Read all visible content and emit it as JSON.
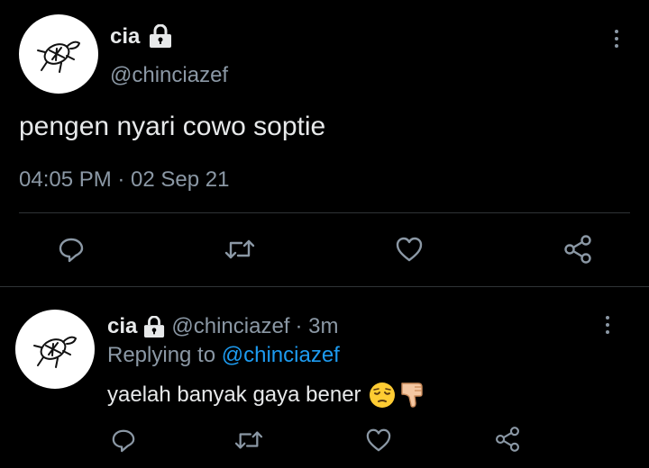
{
  "main_tweet": {
    "display_name": "cia",
    "handle": "@chinciazef",
    "text": "pengen nyari cowo soptie",
    "timestamp": "04:05 PM · 02 Sep 21"
  },
  "reply_tweet": {
    "display_name": "cia",
    "handle": "@chinciazef",
    "time_ago": "· 3m",
    "replying_prefix": "Replying to",
    "replying_handle": "@chinciazef",
    "text": "yaelah banyak gaya bener",
    "emojis": [
      "pensive-face",
      "thumbs-down"
    ]
  },
  "icons": [
    "lock-icon",
    "more-options-icon",
    "reply-icon",
    "retweet-icon",
    "like-icon",
    "share-icon",
    "turtle-avatar-icon"
  ],
  "colors": {
    "background": "#000000",
    "text": "#e7e9ea",
    "muted": "#8b98a5",
    "accent": "#1d9bf0",
    "divider": "#2f3336"
  }
}
